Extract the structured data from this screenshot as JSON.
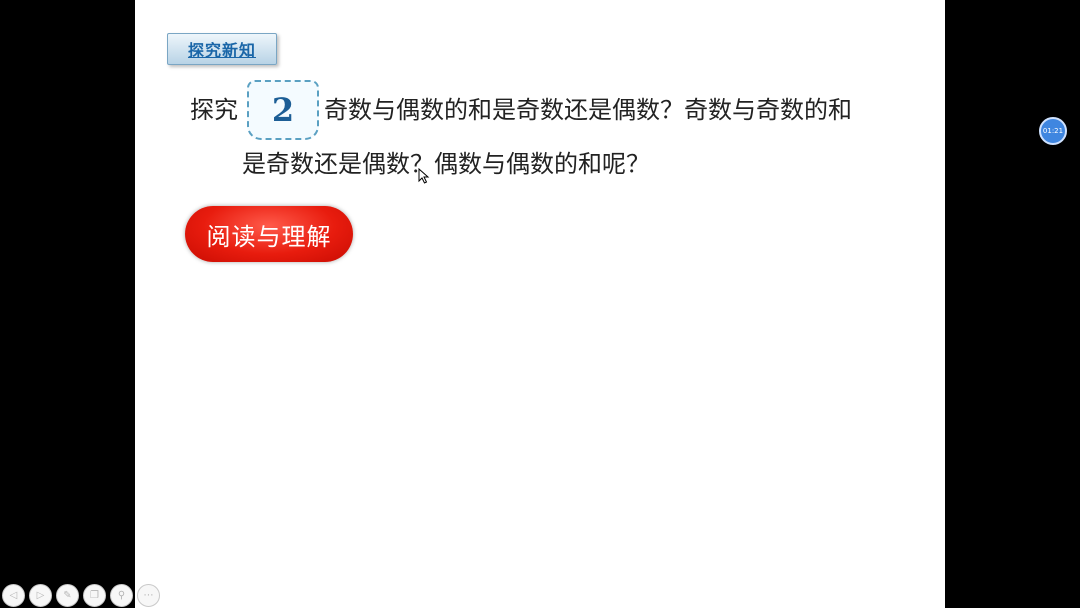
{
  "slide": {
    "section_tag": "探究新知",
    "question": {
      "prefix": "探究",
      "number": "2",
      "line1": "奇数与偶数的和是奇数还是偶数？奇数与奇数的和",
      "line2": "是奇数还是偶数？偶数与偶数的和呢？"
    },
    "read_button": "阅读与理解"
  },
  "toolbar": {
    "buttons": [
      {
        "name": "prev-icon",
        "glyph": "◁"
      },
      {
        "name": "next-icon",
        "glyph": "▷"
      },
      {
        "name": "pen-icon",
        "glyph": "✎"
      },
      {
        "name": "copy-icon",
        "glyph": "❐"
      },
      {
        "name": "zoom-icon",
        "glyph": "⚲"
      },
      {
        "name": "more-icon",
        "glyph": "⋯"
      }
    ]
  },
  "timer": {
    "text": "01:21"
  },
  "colors": {
    "tag_text": "#1a66a8",
    "button_red": "#e81c0e",
    "badge_number": "#1c5e96",
    "timer": "#3f86e0"
  }
}
